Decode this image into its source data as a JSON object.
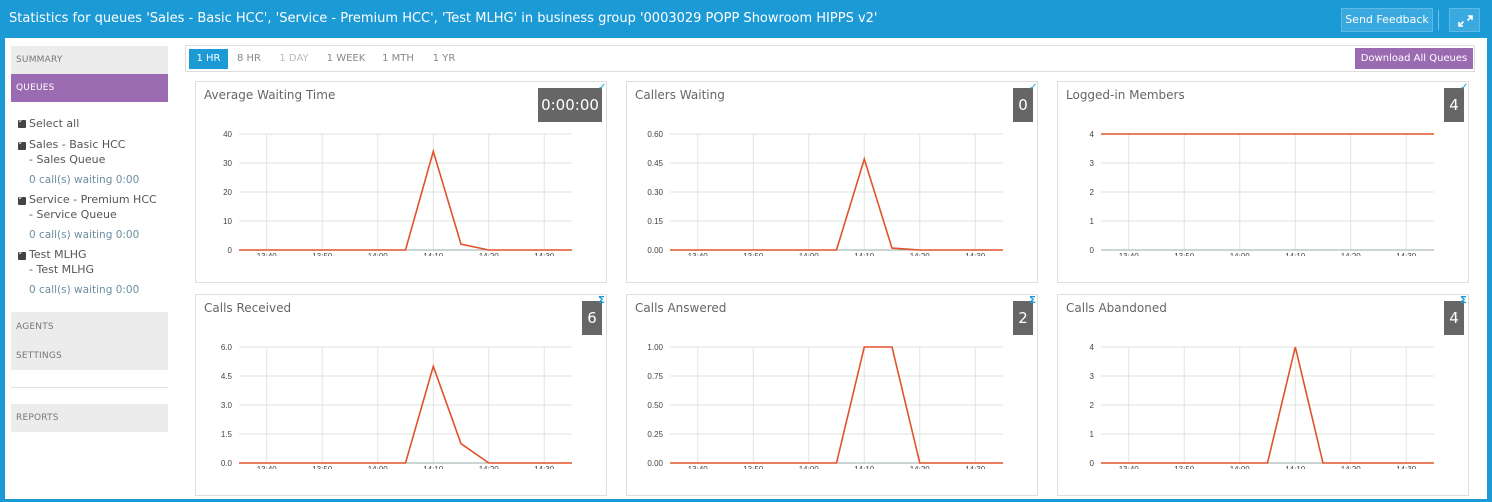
{
  "window": {
    "title": "Statistics for queues 'Sales - Basic HCC', 'Service - Premium HCC', 'Test MLHG' in business group '0003029 POPP Showroom HIPPS v2'",
    "feedback_label": "Send Feedback",
    "expand_icon": "expand-icon"
  },
  "sidebar": {
    "summary": "SUMMARY",
    "queues": "QUEUES",
    "select_all": "Select all",
    "queues_list": [
      {
        "line1": "Sales - Basic HCC",
        "line2": "- Sales Queue",
        "waiting": "0 call(s) waiting 0:00"
      },
      {
        "line1": "Service - Premium HCC",
        "line2": "- Service Queue",
        "waiting": "0 call(s) waiting 0:00"
      },
      {
        "line1": "Test MLHG",
        "line2": "- Test MLHG",
        "waiting": "0 call(s) waiting 0:00"
      }
    ],
    "agents": "AGENTS",
    "settings": "SETTINGS",
    "reports": "REPORTS"
  },
  "range": {
    "buttons": [
      "1 HR",
      "8 HR",
      "1 DAY",
      "1 WEEK",
      "1 MTH",
      "1 YR"
    ],
    "active": "1 HR",
    "download_label": "Download All Queues"
  },
  "colors": {
    "primary": "#1c9ad6",
    "accent": "#9b6bb2",
    "line": "#e0532a",
    "badge": "#666666"
  },
  "cards": [
    {
      "title": "Average Waiting Time",
      "badge": "0:00:00",
      "badge_icon": "pulse-icon"
    },
    {
      "title": "Callers Waiting",
      "badge": "0",
      "badge_icon": "pulse-icon"
    },
    {
      "title": "Logged-in Members",
      "badge": "4",
      "badge_icon": "pulse-icon"
    },
    {
      "title": "Calls Received",
      "badge": "6",
      "badge_icon": "sigma-icon"
    },
    {
      "title": "Calls Answered",
      "badge": "2",
      "badge_icon": "sigma-icon"
    },
    {
      "title": "Calls Abandoned",
      "badge": "4",
      "badge_icon": "sigma-icon"
    }
  ],
  "chart_data": [
    {
      "type": "line",
      "x": [
        "13:35",
        "13:40",
        "13:45",
        "13:50",
        "13:55",
        "14:00",
        "14:05",
        "14:10",
        "14:15",
        "14:20",
        "14:25",
        "14:30",
        "14:35"
      ],
      "xticks": [
        "13:40",
        "13:50",
        "14:00",
        "14:10",
        "14:20",
        "14:30"
      ],
      "yticks": [
        "0",
        "10",
        "20",
        "30",
        "40"
      ],
      "ylim": [
        0,
        40
      ],
      "values": [
        0,
        0,
        0,
        0,
        0,
        0,
        0,
        34,
        2,
        0,
        0,
        0,
        0
      ],
      "grid": true
    },
    {
      "type": "line",
      "x": [
        "13:35",
        "13:40",
        "13:45",
        "13:50",
        "13:55",
        "14:00",
        "14:05",
        "14:10",
        "14:15",
        "14:20",
        "14:25",
        "14:30",
        "14:35"
      ],
      "xticks": [
        "13:40",
        "13:50",
        "14:00",
        "14:10",
        "14:20",
        "14:30"
      ],
      "yticks": [
        "0.00",
        "0.15",
        "0.30",
        "0.45",
        "0.60"
      ],
      "ylim": [
        0,
        0.6
      ],
      "values": [
        0,
        0,
        0,
        0,
        0,
        0,
        0,
        0.47,
        0.01,
        0,
        0,
        0,
        0
      ],
      "grid": true
    },
    {
      "type": "line",
      "x": [
        "13:35",
        "13:40",
        "13:45",
        "13:50",
        "13:55",
        "14:00",
        "14:05",
        "14:10",
        "14:15",
        "14:20",
        "14:25",
        "14:30",
        "14:35"
      ],
      "xticks": [
        "13:40",
        "13:50",
        "14:00",
        "14:10",
        "14:20",
        "14:30"
      ],
      "yticks": [
        "0",
        "1",
        "2",
        "3",
        "4"
      ],
      "ylim": [
        0,
        4
      ],
      "values": [
        4,
        4,
        4,
        4,
        4,
        4,
        4,
        4,
        4,
        4,
        4,
        4,
        4
      ],
      "grid": true
    },
    {
      "type": "line",
      "x": [
        "13:35",
        "13:40",
        "13:45",
        "13:50",
        "13:55",
        "14:00",
        "14:05",
        "14:10",
        "14:15",
        "14:20",
        "14:25",
        "14:30",
        "14:35"
      ],
      "xticks": [
        "13:40",
        "13:50",
        "14:00",
        "14:10",
        "14:20",
        "14:30"
      ],
      "yticks": [
        "0.0",
        "1.5",
        "3.0",
        "4.5",
        "6.0"
      ],
      "ylim": [
        0,
        6
      ],
      "values": [
        0,
        0,
        0,
        0,
        0,
        0,
        0,
        5,
        1,
        0,
        0,
        0,
        0
      ],
      "grid": true
    },
    {
      "type": "line",
      "x": [
        "13:35",
        "13:40",
        "13:45",
        "13:50",
        "13:55",
        "14:00",
        "14:05",
        "14:10",
        "14:15",
        "14:20",
        "14:25",
        "14:30",
        "14:35"
      ],
      "xticks": [
        "13:40",
        "13:50",
        "14:00",
        "14:10",
        "14:20",
        "14:30"
      ],
      "yticks": [
        "0.00",
        "0.25",
        "0.50",
        "0.75",
        "1.00"
      ],
      "ylim": [
        0,
        1
      ],
      "values": [
        0,
        0,
        0,
        0,
        0,
        0,
        0,
        1,
        1,
        0,
        0,
        0,
        0
      ],
      "grid": true
    },
    {
      "type": "line",
      "x": [
        "13:35",
        "13:40",
        "13:45",
        "13:50",
        "13:55",
        "14:00",
        "14:05",
        "14:10",
        "14:15",
        "14:20",
        "14:25",
        "14:30",
        "14:35"
      ],
      "xticks": [
        "13:40",
        "13:50",
        "14:00",
        "14:10",
        "14:20",
        "14:30"
      ],
      "yticks": [
        "0",
        "1",
        "2",
        "3",
        "4"
      ],
      "ylim": [
        0,
        4
      ],
      "values": [
        0,
        0,
        0,
        0,
        0,
        0,
        0,
        4,
        0,
        0,
        0,
        0,
        0
      ],
      "grid": true
    }
  ]
}
